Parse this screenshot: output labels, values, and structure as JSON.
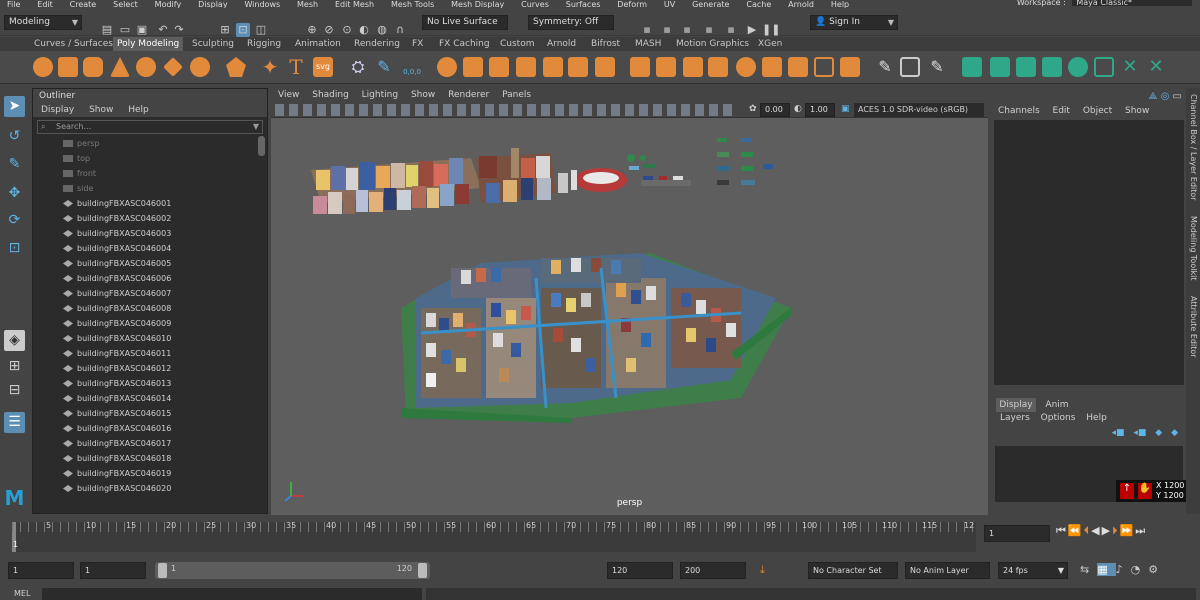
{
  "menubar": {
    "items": [
      "File",
      "Edit",
      "Create",
      "Select",
      "Modify",
      "Display",
      "Windows",
      "Mesh",
      "Edit Mesh",
      "Mesh Tools",
      "Mesh Display",
      "Curves",
      "Surfaces",
      "Deform",
      "UV",
      "Generate",
      "Cache",
      "Arnold",
      "Help"
    ],
    "workspace_label": "Workspace :",
    "workspace_value": "Maya Classic*"
  },
  "statusline": {
    "mode": "Modeling",
    "live_surface": "No Live Surface",
    "symmetry": "Symmetry: Off",
    "signin": "Sign In"
  },
  "shelf": {
    "tabs": [
      "Curves / Surfaces",
      "Poly Modeling",
      "Sculpting",
      "Rigging",
      "Animation",
      "Rendering",
      "FX",
      "FX Caching",
      "Custom",
      "Arnold",
      "Bifrost",
      "MASH",
      "Motion Graphics",
      "XGen"
    ],
    "active_tab": "Poly Modeling",
    "text_icons": {
      "T": "T",
      "svg": "svg",
      "coords": "0,0,0"
    }
  },
  "outliner": {
    "title": "Outliner",
    "menu": [
      "Display",
      "Show",
      "Help"
    ],
    "search_placeholder": "Search...",
    "cameras": [
      "persp",
      "top",
      "front",
      "side"
    ],
    "items": [
      "buildingFBXASC046001",
      "buildingFBXASC046002",
      "buildingFBXASC046003",
      "buildingFBXASC046004",
      "buildingFBXASC046005",
      "buildingFBXASC046006",
      "buildingFBXASC046007",
      "buildingFBXASC046008",
      "buildingFBXASC046009",
      "buildingFBXASC046010",
      "buildingFBXASC046011",
      "buildingFBXASC046012",
      "buildingFBXASC046013",
      "buildingFBXASC046014",
      "buildingFBXASC046015",
      "buildingFBXASC046016",
      "buildingFBXASC046017",
      "buildingFBXASC046018",
      "buildingFBXASC046019",
      "buildingFBXASC046020"
    ]
  },
  "viewport": {
    "menu": [
      "View",
      "Shading",
      "Lighting",
      "Show",
      "Renderer",
      "Panels"
    ],
    "exposure": "0.00",
    "gamma": "1.00",
    "colorspace": "ACES 1.0 SDR-video (sRGB)",
    "camera_label": "persp"
  },
  "channelbox": {
    "menu": [
      "Channels",
      "Edit",
      "Object",
      "Show"
    ]
  },
  "layers": {
    "tabs": [
      "Display",
      "Anim"
    ],
    "active_tab": "Display",
    "menu": [
      "Layers",
      "Options",
      "Help"
    ]
  },
  "side_tabs": [
    "Channel Box / Layer Editor",
    "Modeling Toolkit",
    "Attribute Editor"
  ],
  "resolution": {
    "x": "X 1200",
    "y": "Y 1200"
  },
  "timeline": {
    "ticks": [
      "5",
      "10",
      "15",
      "20",
      "25",
      "30",
      "35",
      "40",
      "45",
      "50",
      "55",
      "60",
      "65",
      "70",
      "75",
      "80",
      "85",
      "90",
      "95",
      "100",
      "105",
      "110",
      "115",
      "12"
    ],
    "start_marker": "1",
    "current_frame": "1"
  },
  "range": {
    "start": "1",
    "anim_start": "1",
    "slider_start": "1",
    "slider_end": "120",
    "end": "120",
    "anim_end": "200",
    "character_set": "No Character Set",
    "anim_layer": "No Anim Layer",
    "fps": "24 fps"
  },
  "mel": {
    "label": "MEL"
  }
}
